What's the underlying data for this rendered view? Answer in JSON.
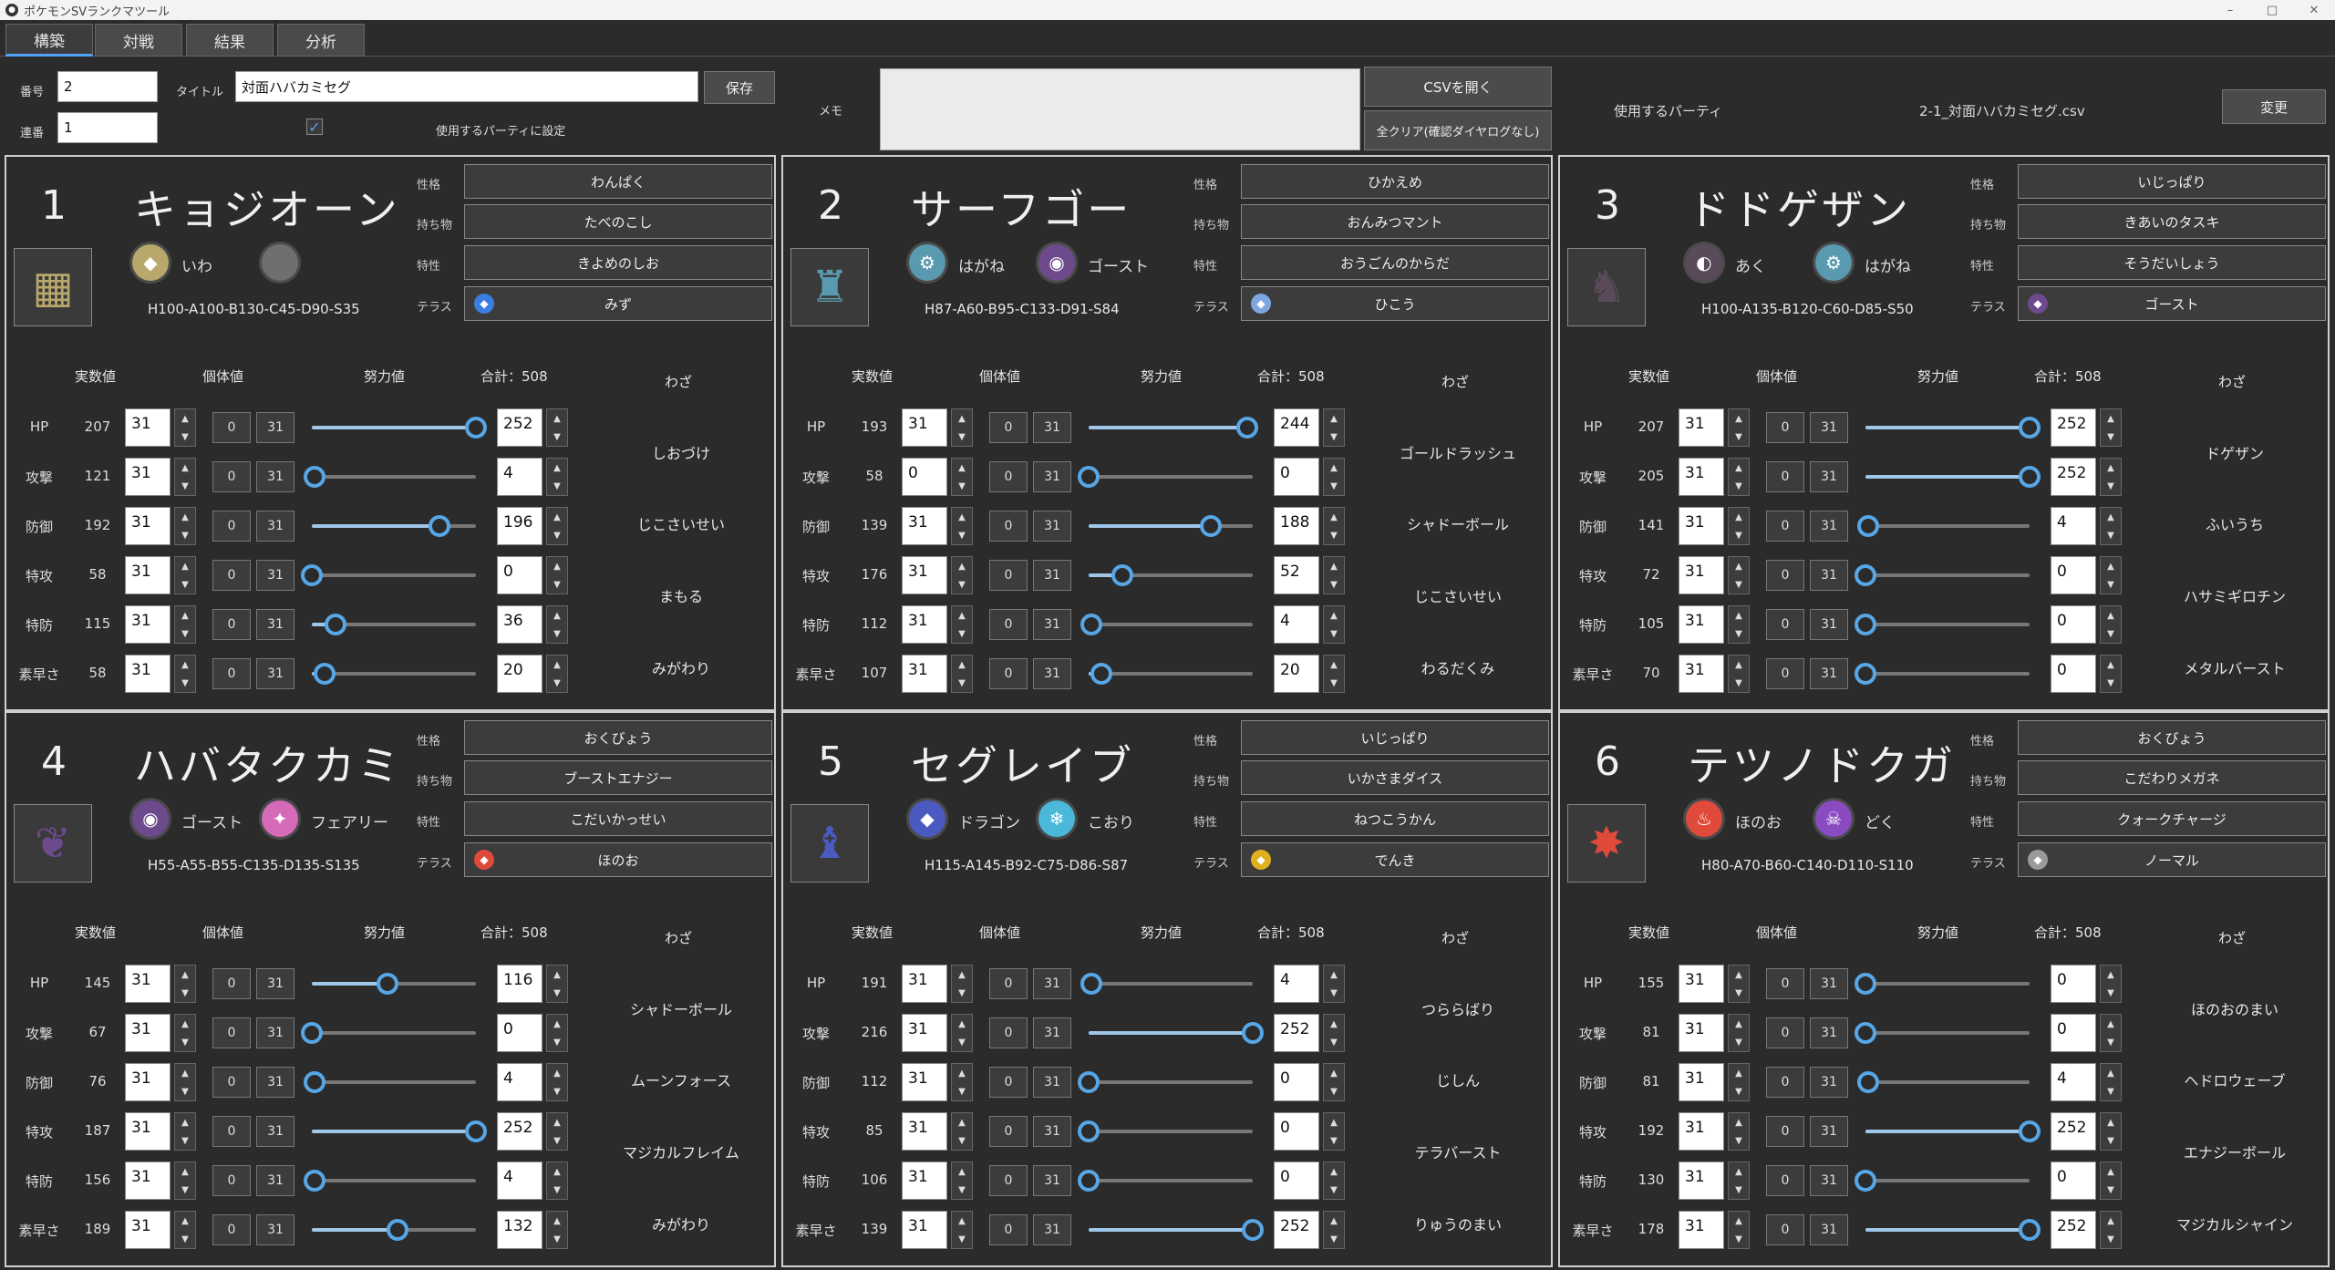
{
  "window": {
    "title": "ポケモンSVランクマツール",
    "minimize": "–",
    "maximize": "□",
    "close": "✕"
  },
  "tabs": [
    {
      "label": "構築"
    },
    {
      "label": "対戦"
    },
    {
      "label": "結果"
    },
    {
      "label": "分析"
    }
  ],
  "header": {
    "number_label": "番号",
    "number_value": "2",
    "seq_label": "連番",
    "seq_value": "1",
    "title_label": "タイトル",
    "title_value": "対面ハバカミセグ",
    "save_button": "保存",
    "use_party_label": "使用するパーティに設定",
    "use_party_checked": true,
    "memo_label": "メモ",
    "memo_value": "",
    "open_csv_button": "CSVを開く",
    "clear_all_button": "全クリア(確認ダイヤログなし)",
    "party_label": "使用するパーティ",
    "party_file": "2-1_対面ハバカミセグ.csv",
    "change_button": "変更"
  },
  "labels": {
    "nature": "性格",
    "item": "持ち物",
    "ability": "特性",
    "tera": "テラス",
    "col_stat": "実数値",
    "col_iv": "個体値",
    "col_ev": "努力値",
    "ev_total": "合計：508",
    "col_moves": "わざ"
  },
  "stat_names": [
    "HP",
    "攻撃",
    "防御",
    "特攻",
    "特防",
    "素早さ"
  ],
  "party": [
    {
      "num": "1",
      "name": "キョジオーン",
      "sprite": "salt-pillar",
      "type1": {
        "name": "いわ",
        "color": "#b8a86b",
        "glyph": "◆"
      },
      "type2": null,
      "type2_icon_color": "#6f6f6f",
      "base": "H100-A100-B130-C45-D90-S35",
      "nature": "わんぱく",
      "item": "たべのこし",
      "ability": "きよめのしお",
      "tera": {
        "name": "みず",
        "color": "#3a7ee0"
      },
      "stats": [
        207,
        121,
        192,
        58,
        115,
        58
      ],
      "ivs": [
        31,
        31,
        31,
        31,
        31,
        31
      ],
      "evs": [
        252,
        4,
        196,
        0,
        36,
        20
      ],
      "moves": [
        "しおづけ",
        "じこさいせい",
        "まもる",
        "みがわり"
      ]
    },
    {
      "num": "2",
      "name": "サーフゴー",
      "sprite": "gold-figure",
      "type1": {
        "name": "はがね",
        "color": "#5a9ab0",
        "glyph": "⚙"
      },
      "type2": {
        "name": "ゴースト",
        "color": "#6d4a8c",
        "glyph": "◉"
      },
      "base": "H87-A60-B95-C133-D91-S84",
      "nature": "ひかえめ",
      "item": "おんみつマント",
      "ability": "おうごんのからだ",
      "tera": {
        "name": "ひこう",
        "color": "#7ea6e0"
      },
      "stats": [
        193,
        58,
        139,
        176,
        112,
        107
      ],
      "ivs": [
        31,
        0,
        31,
        31,
        31,
        31
      ],
      "evs": [
        244,
        0,
        188,
        52,
        4,
        20
      ],
      "moves": [
        "ゴールドラッシュ",
        "シャドーボール",
        "じこさいせい",
        "わるだくみ"
      ]
    },
    {
      "num": "3",
      "name": "ドドゲザン",
      "sprite": "dark-blade",
      "type1": {
        "name": "あく",
        "color": "#5a4a5a",
        "glyph": "◐"
      },
      "type2": {
        "name": "はがね",
        "color": "#5a9ab0",
        "glyph": "⚙"
      },
      "base": "H100-A135-B120-C60-D85-S50",
      "nature": "いじっぱり",
      "item": "きあいのタスキ",
      "ability": "そうだいしょう",
      "tera": {
        "name": "ゴースト",
        "color": "#6d4a8c"
      },
      "stats": [
        207,
        205,
        141,
        72,
        105,
        70
      ],
      "ivs": [
        31,
        31,
        31,
        31,
        31,
        31
      ],
      "evs": [
        252,
        252,
        4,
        0,
        0,
        0
      ],
      "moves": [
        "ドゲザン",
        "ふいうち",
        "ハサミギロチン",
        "メタルバースト"
      ]
    },
    {
      "num": "4",
      "name": "ハバタクカミ",
      "sprite": "ghost-wings",
      "type1": {
        "name": "ゴースト",
        "color": "#6d4a8c",
        "glyph": "◉"
      },
      "type2": {
        "name": "フェアリー",
        "color": "#d46ab8",
        "glyph": "✦"
      },
      "base": "H55-A55-B55-C135-D135-S135",
      "nature": "おくびょう",
      "item": "ブーストエナジー",
      "ability": "こだいかっせい",
      "tera": {
        "name": "ほのお",
        "color": "#e04a3a"
      },
      "stats": [
        145,
        67,
        76,
        187,
        156,
        189
      ],
      "ivs": [
        31,
        31,
        31,
        31,
        31,
        31
      ],
      "evs": [
        116,
        0,
        4,
        252,
        4,
        132
      ],
      "moves": [
        "シャドーボール",
        "ムーンフォース",
        "マジカルフレイム",
        "みがわり"
      ]
    },
    {
      "num": "5",
      "name": "セグレイブ",
      "sprite": "ice-dragon",
      "type1": {
        "name": "ドラゴン",
        "color": "#4a5ac0",
        "glyph": "◆"
      },
      "type2": {
        "name": "こおり",
        "color": "#4ab8d8",
        "glyph": "❄"
      },
      "base": "H115-A145-B92-C75-D86-S87",
      "nature": "いじっぱり",
      "item": "いかさまダイス",
      "ability": "ねつこうかん",
      "tera": {
        "name": "でんき",
        "color": "#e0b020"
      },
      "stats": [
        191,
        216,
        112,
        85,
        106,
        139
      ],
      "ivs": [
        31,
        31,
        31,
        31,
        31,
        31
      ],
      "evs": [
        4,
        252,
        0,
        0,
        0,
        252
      ],
      "moves": [
        "つららばり",
        "じしん",
        "テラバースト",
        "りゅうのまい"
      ]
    },
    {
      "num": "6",
      "name": "テツノドクガ",
      "sprite": "iron-moth",
      "type1": {
        "name": "ほのお",
        "color": "#e04a3a",
        "glyph": "♨"
      },
      "type2": {
        "name": "どく",
        "color": "#8a4ac0",
        "glyph": "☠"
      },
      "base": "H80-A70-B60-C140-D110-S110",
      "nature": "おくびょう",
      "item": "こだわりメガネ",
      "ability": "クォークチャージ",
      "tera": {
        "name": "ノーマル",
        "color": "#9a9a9a"
      },
      "stats": [
        155,
        81,
        81,
        192,
        130,
        178
      ],
      "ivs": [
        31,
        31,
        31,
        31,
        31,
        31
      ],
      "evs": [
        0,
        0,
        4,
        252,
        0,
        252
      ],
      "moves": [
        "ほのおのまい",
        "ヘドロウェーブ",
        "エナジーボール",
        "マジカルシャイン"
      ]
    }
  ],
  "minis": {
    "min": "0",
    "max": "31"
  }
}
